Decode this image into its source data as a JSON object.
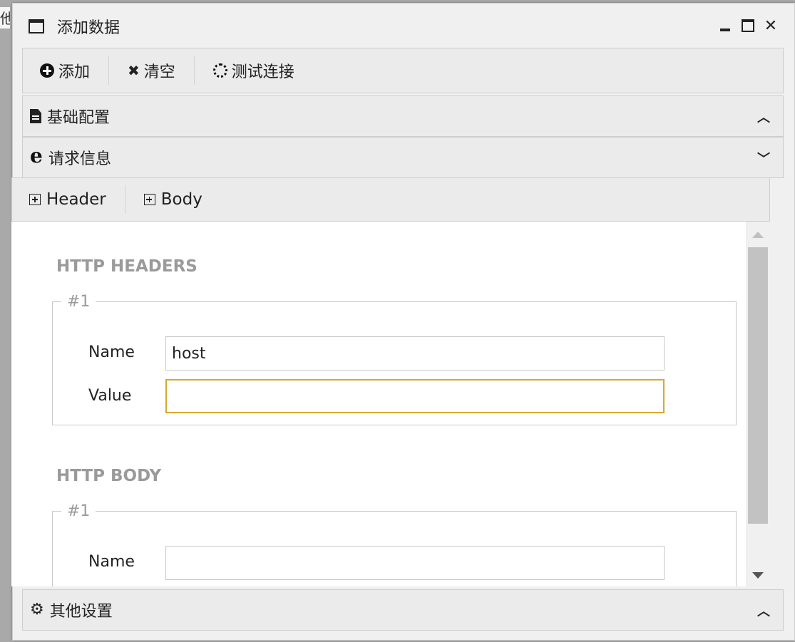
{
  "background": {
    "fragment_text": "他"
  },
  "window": {
    "title": "添加数据",
    "controls": {
      "minimize": "minimize",
      "maximize": "maximize",
      "close": "✕"
    }
  },
  "toolbar": {
    "add_label": "添加",
    "clear_label": "清空",
    "test_label": "测试连接"
  },
  "sections": {
    "basic": {
      "label": "基础配置",
      "icon": "file-text-icon",
      "state": "collapsed",
      "chevron": "⌃"
    },
    "request": {
      "label": "请求信息",
      "icon": "edge-icon",
      "state": "expanded",
      "chevron": "⌄"
    },
    "other": {
      "label": "其他设置",
      "icon": "cogs-icon",
      "state": "collapsed",
      "chevron": "⌃"
    }
  },
  "subtoolbar": {
    "header_label": "Header",
    "body_label": "Body"
  },
  "headers_section": {
    "title": "HTTP HEADERS",
    "group_legend": "#1",
    "name_label": "Name",
    "name_value": "host",
    "value_label": "Value",
    "value_value": ""
  },
  "body_section": {
    "title": "HTTP BODY",
    "group_legend": "#1",
    "name_label": "Name",
    "name_value": ""
  },
  "colors": {
    "focus_border": "#d8a82e",
    "section_title": "#9a9a9a",
    "panel_bg": "#ebebeb"
  }
}
